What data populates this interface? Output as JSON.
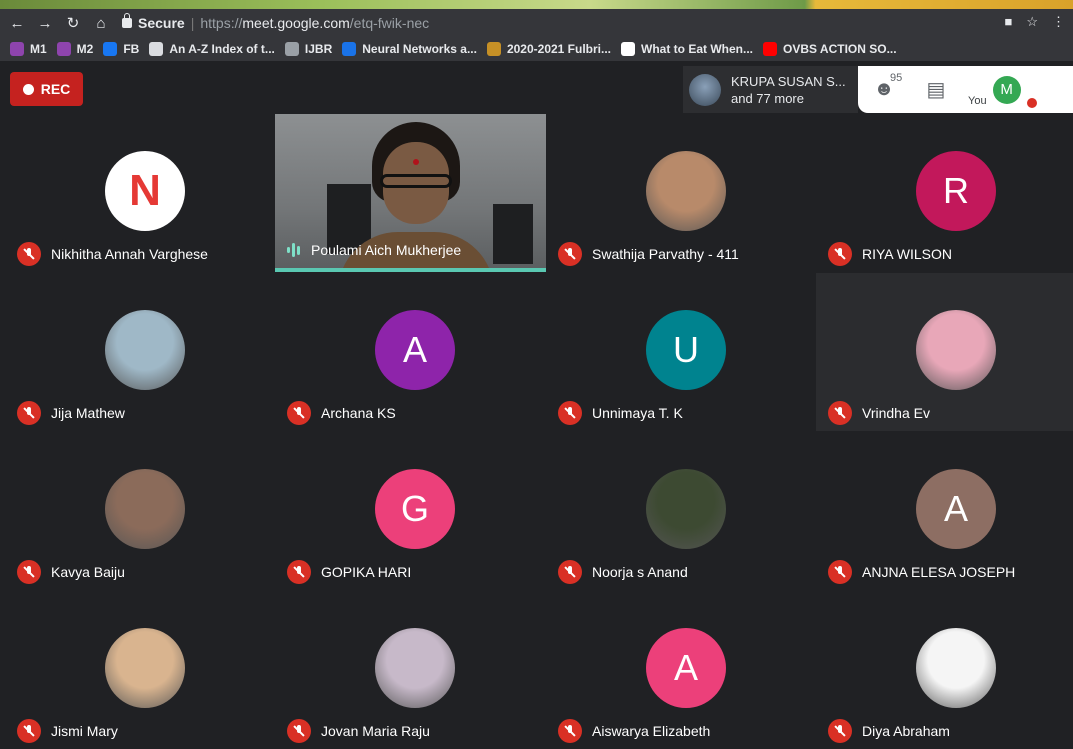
{
  "browser": {
    "secure_label": "Secure",
    "url_scheme": "https://",
    "url_host": "meet.google.com",
    "url_path": "/etq-fwik-nec",
    "bookmarks": [
      {
        "label": "M1",
        "color": "#8e44ad"
      },
      {
        "label": "M2",
        "color": "#8e44ad"
      },
      {
        "label": "FB",
        "color": "#1877f2"
      },
      {
        "label": "An A-Z Index of t...",
        "color": "#dadce0"
      },
      {
        "label": "IJBR",
        "color": "#9aa0a6"
      },
      {
        "label": "Neural Networks a...",
        "color": "#1a73e8"
      },
      {
        "label": "2020-2021 Fulbri...",
        "color": "#c69026"
      },
      {
        "label": "What to Eat When...",
        "color": "#ffffff"
      },
      {
        "label": "OVBS ACTION SO...",
        "color": "#ff0000"
      }
    ]
  },
  "meet": {
    "rec_label": "REC",
    "presenter_name": "KRUPA SUSAN S...",
    "presenter_more": "and 77 more",
    "people_count": "95",
    "you_label": "You",
    "self_initial": "M",
    "participants": [
      {
        "name": "Nikhitha Annah Varghese",
        "initial": "N",
        "color": "#ffffff",
        "text_color": "#e53935",
        "muted": true
      },
      {
        "name": "Poulami Aich Mukherjee",
        "video": true,
        "speaking": true
      },
      {
        "name": "Swathija Parvathy - 411",
        "photo": true,
        "color": "#b88a6a",
        "muted": true
      },
      {
        "name": "RIYA WILSON",
        "initial": "R",
        "color": "#c2185b",
        "muted": true
      },
      {
        "name": "Jija Mathew",
        "photo": true,
        "color": "#9fb8c7",
        "muted": true
      },
      {
        "name": "Archana KS",
        "initial": "A",
        "color": "#8e24aa",
        "muted": true
      },
      {
        "name": "Unnimaya T. K",
        "initial": "U",
        "color": "#00838f",
        "muted": true
      },
      {
        "name": "Vrindha Ev",
        "photo": true,
        "color": "#e8a7b8",
        "muted": true,
        "highlighted": true
      },
      {
        "name": "Kavya Baiju",
        "photo": true,
        "color": "#8b6b5a",
        "muted": true
      },
      {
        "name": "GOPIKA HARI",
        "initial": "G",
        "color": "#ec407a",
        "muted": true
      },
      {
        "name": "Noorja s Anand",
        "photo": true,
        "color": "#3d4a32",
        "muted": true
      },
      {
        "name": "ANJNA ELESA JOSEPH",
        "initial": "A",
        "color": "#8d6e63",
        "muted": true
      },
      {
        "name": "Jismi Mary",
        "photo": true,
        "color": "#d9b48f",
        "muted": true
      },
      {
        "name": "Jovan Maria Raju",
        "photo": true,
        "color": "#c7b9c9",
        "muted": true
      },
      {
        "name": "Aiswarya Elizabeth",
        "initial": "A",
        "color": "#ec407a",
        "muted": true
      },
      {
        "name": "Diya Abraham",
        "photo": true,
        "color": "#f5f5f5",
        "muted": true
      }
    ]
  }
}
